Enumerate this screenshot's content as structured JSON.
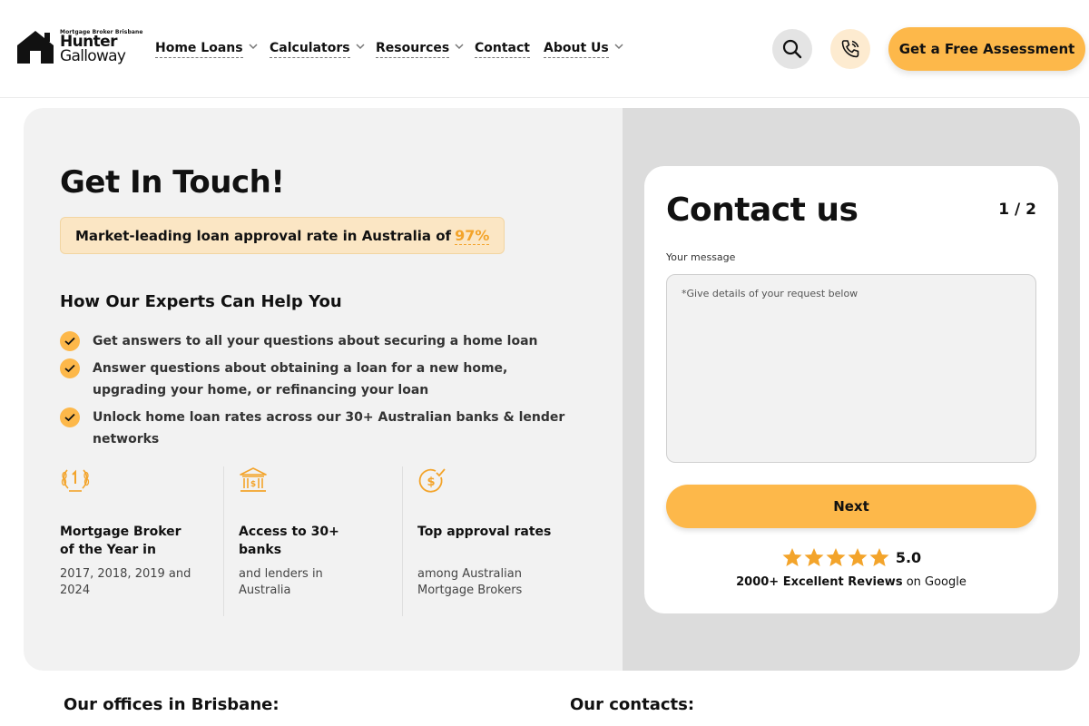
{
  "header": {
    "logo": {
      "tagline": "Mortgage Broker Brisbane",
      "line1": "Hunter",
      "line2": "Galloway"
    },
    "nav": [
      {
        "label": "Home Loans",
        "has_dropdown": true
      },
      {
        "label": "Calculators",
        "has_dropdown": true
      },
      {
        "label": "Resources",
        "has_dropdown": true
      },
      {
        "label": "Contact",
        "has_dropdown": false
      },
      {
        "label": "About Us",
        "has_dropdown": true
      }
    ],
    "search_icon": "search-icon",
    "phone_icon": "phone-icon",
    "cta_label": "Get a Free Assessment"
  },
  "hero": {
    "title": "Get In Touch!",
    "badge_text": "Market-leading loan approval rate in Australia of",
    "badge_value": "97%",
    "subtitle": "How Our Experts Can Help You",
    "benefits": [
      "Get answers to all your questions about securing a home loan",
      "Answer questions about obtaining a loan for a new home, upgrading your home, or refinancing your loan",
      "Unlock home loan rates across our 30+ Australian banks & lender networks"
    ],
    "stats": [
      {
        "icon": "award-laurel-icon",
        "title": "Mortgage Broker of the Year in",
        "sub": "2017, 2018, 2019 and 2024"
      },
      {
        "icon": "bank-icon",
        "title": "Access to 30+ banks",
        "sub": "and lenders in Australia"
      },
      {
        "icon": "approval-dollar-icon",
        "title": "Top approval rates",
        "sub": "among Australian Mortgage Brokers"
      }
    ]
  },
  "form": {
    "title": "Contact us",
    "step": "1 / 2",
    "message_label": "Your message",
    "message_placeholder": "*Give details of your request below",
    "next_label": "Next",
    "rating": "5.0",
    "stars_count": 5,
    "reviews_bold": "2000+ Excellent Reviews",
    "reviews_suffix": "on Google"
  },
  "footer": {
    "offices_heading": "Our offices in Brisbane:",
    "contacts_heading": "Our contacts:"
  },
  "colors": {
    "accent": "#fdb84a",
    "badge_bg": "#fbe6c4",
    "panel_left": "#f2f2f2",
    "panel_right": "#dcdcdc"
  }
}
